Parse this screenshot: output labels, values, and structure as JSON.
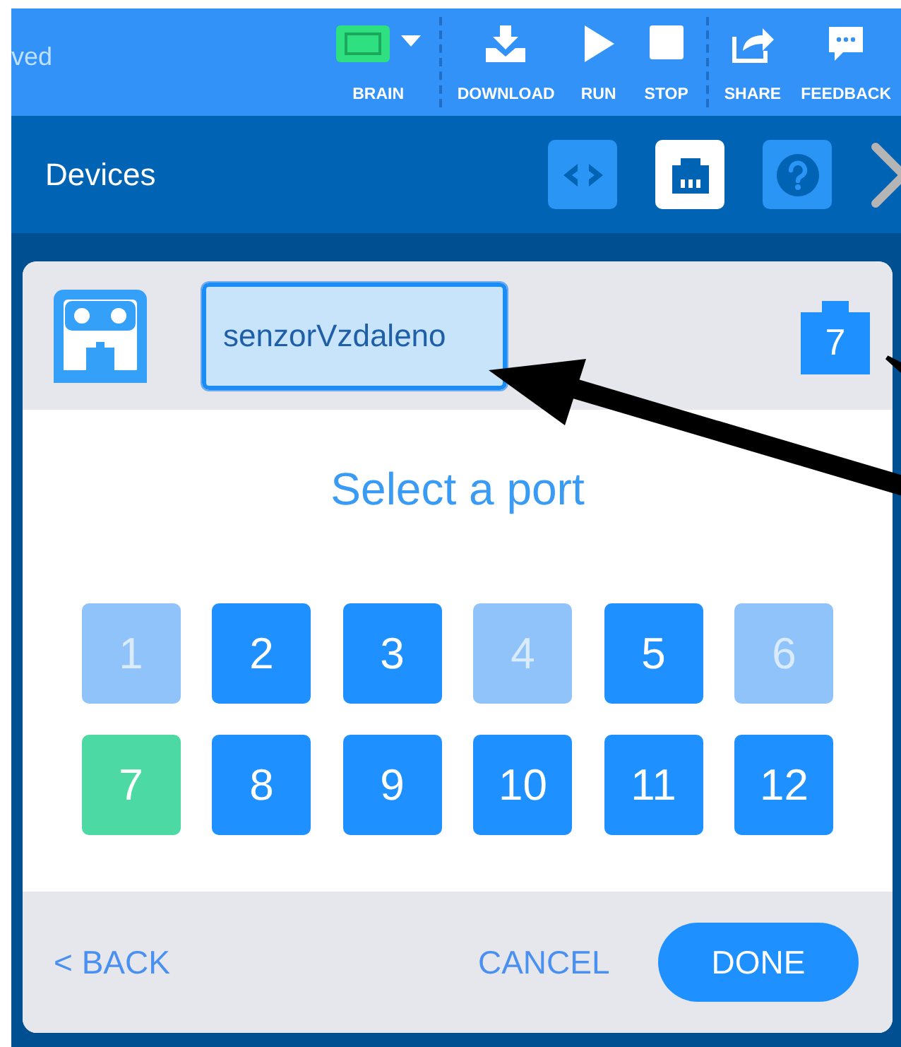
{
  "toolbar": {
    "status_text": "ved",
    "tool_groups": [
      [
        {
          "kind": "brain",
          "label": "BRAIN"
        }
      ],
      [
        {
          "kind": "download",
          "label": "DOWNLOAD"
        },
        {
          "kind": "run",
          "label": "RUN"
        },
        {
          "kind": "stop",
          "label": "STOP"
        }
      ],
      [
        {
          "kind": "share",
          "label": "SHARE"
        },
        {
          "kind": "feedback",
          "label": "FEEDBACK"
        }
      ]
    ]
  },
  "devices_bar": {
    "title": "Devices",
    "tabs": [
      {
        "kind": "code",
        "selected": false
      },
      {
        "kind": "ports",
        "selected": true
      },
      {
        "kind": "help",
        "selected": false
      }
    ]
  },
  "dialog": {
    "device_name": "senzorVzdaleno",
    "port_badge": "7",
    "heading": "Select a port",
    "ports": [
      {
        "label": "1",
        "selected": false,
        "disabled": true
      },
      {
        "label": "2",
        "selected": false,
        "disabled": false
      },
      {
        "label": "3",
        "selected": false,
        "disabled": false
      },
      {
        "label": "4",
        "selected": false,
        "disabled": true
      },
      {
        "label": "5",
        "selected": false,
        "disabled": false
      },
      {
        "label": "6",
        "selected": false,
        "disabled": true
      },
      {
        "label": "7",
        "selected": true,
        "disabled": false
      },
      {
        "label": "8",
        "selected": false,
        "disabled": false
      },
      {
        "label": "9",
        "selected": false,
        "disabled": false
      },
      {
        "label": "10",
        "selected": false,
        "disabled": false
      },
      {
        "label": "11",
        "selected": false,
        "disabled": false
      },
      {
        "label": "12",
        "selected": false,
        "disabled": false
      }
    ],
    "buttons": [
      {
        "kind": "back",
        "label": "< BACK"
      },
      {
        "kind": "cancel",
        "label": "CANCEL"
      },
      {
        "kind": "done",
        "label": "DONE"
      }
    ]
  }
}
